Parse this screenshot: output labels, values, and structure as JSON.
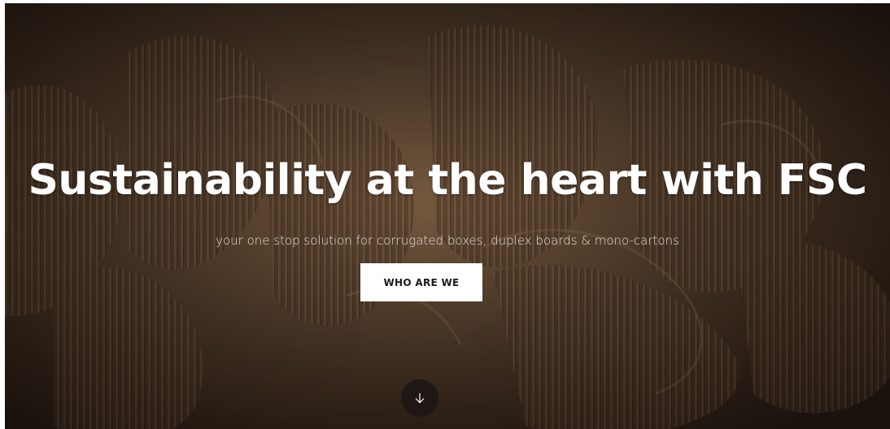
{
  "hero": {
    "headline": "Sustainability at the heart with FSC",
    "subtitle": "your one stop solution for corrugated boxes, duplex boards & mono-cartons",
    "cta_label": "WHO ARE WE",
    "scroll_icon": "arrow-down-icon"
  },
  "colors": {
    "cta_background": "#ffffff",
    "headline_text": "#ffffff",
    "background_tone": "#6b4c34"
  }
}
